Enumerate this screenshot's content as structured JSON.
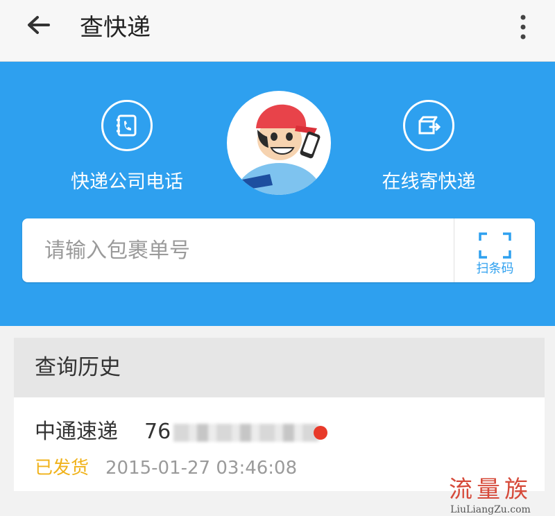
{
  "header": {
    "title": "查快递",
    "back_icon": "back-arrow-icon",
    "more_icon": "more-vertical-icon"
  },
  "banner": {
    "background_color": "#2ea0ef",
    "left_action": {
      "label": "快递公司电话",
      "icon": "phone-book-icon"
    },
    "right_action": {
      "label": "在线寄快递",
      "icon": "send-package-icon"
    },
    "mascot": "courier-mascot"
  },
  "search": {
    "placeholder": "请输入包裹单号",
    "value": "",
    "scan_label": "扫条码",
    "scan_icon": "scan-frame-icon"
  },
  "history": {
    "title": "查询历史",
    "items": [
      {
        "company": "中通速递",
        "tracking_visible": "76",
        "status": "已发货",
        "datetime": "2015-01-27 03:46:08",
        "status_color": "#f0b21a",
        "unread_dot_color": "#e83a2a"
      }
    ]
  },
  "watermark": {
    "cn": "流量族",
    "en": "LiuLiangZu.com"
  }
}
